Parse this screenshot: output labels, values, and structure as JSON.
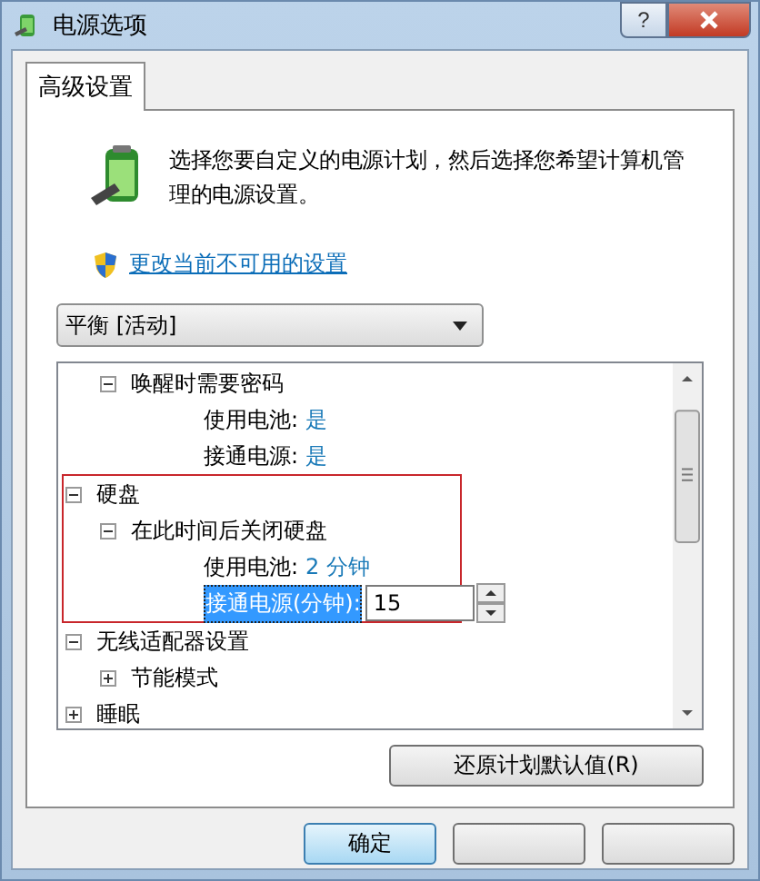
{
  "window": {
    "title": "电源选项",
    "help_button": "?"
  },
  "tabs": [
    {
      "label": "高级设置",
      "selected": true
    }
  ],
  "description": "选择您要自定义的电源计划，然后选择您希望计算机管理的电源设置。",
  "link": "更改当前不可用的设置",
  "plan_dropdown": {
    "value": "平衡 [活动]"
  },
  "tree": [
    {
      "children": [
        {
          "label": "唤醒时需要密码",
          "expanded": true,
          "children": [
            {
              "kind": "setting",
              "label": "使用电池:",
              "value": "是"
            },
            {
              "kind": "setting",
              "label": "接通电源:",
              "value": "是"
            }
          ]
        }
      ]
    },
    {
      "label": "硬盘",
      "expanded": true,
      "highlighted": true,
      "children": [
        {
          "label": "在此时间后关闭硬盘",
          "expanded": true,
          "children": [
            {
              "kind": "setting",
              "label": "使用电池:",
              "value": "2 分钟"
            },
            {
              "kind": "edit",
              "label": "接通电源(分钟):",
              "value": "15",
              "selected": true
            }
          ]
        }
      ]
    },
    {
      "label": "无线适配器设置",
      "expanded": true,
      "highlighted": false,
      "children": [
        {
          "label": "节能模式",
          "expanded": false
        }
      ]
    },
    {
      "label": "睡眠",
      "expanded": false,
      "highlighted": false
    }
  ],
  "restore_button": "还原计划默认值(R)",
  "ok_button": "确定"
}
